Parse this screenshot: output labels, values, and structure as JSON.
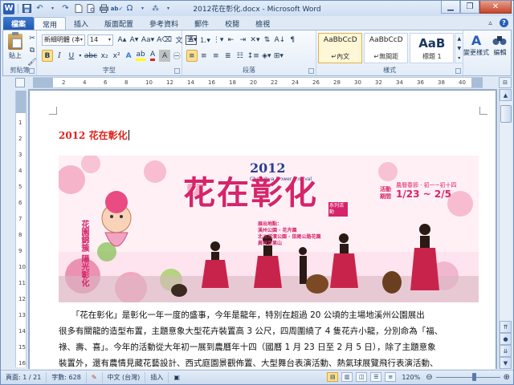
{
  "window": {
    "title": "2012花在彰化.docx - Microsoft Word"
  },
  "qat": {
    "app_icon": "W"
  },
  "tabs": {
    "file": "檔案",
    "items": [
      "常用",
      "插入",
      "版面配置",
      "參考資料",
      "郵件",
      "校閱",
      "檢視"
    ],
    "active_index": 0
  },
  "ribbon": {
    "clipboard": {
      "label": "剪貼簿",
      "paste": "貼上"
    },
    "font": {
      "label": "字型",
      "name": "新細明體 (本文",
      "size": "14"
    },
    "paragraph": {
      "label": "段落"
    },
    "styles": {
      "label": "樣式",
      "items": [
        {
          "sample": "AaBbCcD",
          "name": "↵內文"
        },
        {
          "sample": "AaBbCcD",
          "name": "↵無間距"
        },
        {
          "sample": "AaB",
          "name": "標題 1"
        }
      ],
      "selected_index": 0,
      "change_styles": "變更樣式"
    },
    "editing": {
      "label": "編輯"
    }
  },
  "ruler": {
    "numbers": [
      "2",
      "4",
      "6",
      "8",
      "10",
      "12",
      "14",
      "16",
      "18",
      "20",
      "22",
      "24",
      "26",
      "28",
      "30",
      "32",
      "34",
      "36",
      "38",
      "40"
    ],
    "v_numbers": [
      "1",
      "2",
      "3",
      "4",
      "5",
      "6",
      "7",
      "8",
      "9",
      "10",
      "11",
      "12",
      "13",
      "14",
      "15",
      "16"
    ]
  },
  "document": {
    "heading": "2012 花在彰化",
    "photo": {
      "year": "2012",
      "sub": "Changhua Flower Festival",
      "title": "花在彰化",
      "series": "系列活動",
      "date_label": "活動期間",
      "date_range": "農曆春節 · 初一~初十四",
      "dates": "1/23 ~ 2/5",
      "side_text": "花園錦簇 陽光彰化",
      "venue_lines": [
        "展出地點：",
        "溪州公園 · 花卉園",
        "北斗河濱公園 · 田尾公路花園",
        "員林百果山"
      ]
    },
    "paragraph_lines": [
      "　　「花在彰化」是彰化一年一度的盛事，今年是龍年，特別在超過 20 公頃的主場地溪州公園展出",
      "很多有關龍的造型布置，主題意象大型花卉裝置高 3 公尺，四周圍繞了 4 隻花卉小龍，分別命為「福、",
      "祿、壽、喜」。今年的活動從大年初一展到農曆年十四（國曆 1 月 23 日至 2 月 5 日），除了主題意象",
      "裝置外，還有農情見藏花藝設計、西式庭園景觀佈置、大型舞台表演活動、熱氣球展覽飛行表演活動、"
    ]
  },
  "status": {
    "page": "頁面: 1 / 21",
    "words": "字數: 628",
    "language": "中文 (台灣)",
    "mode": "插入",
    "zoom": "120%",
    "zoom_level": 0.6
  },
  "colors": {
    "accent": "#2b5db6",
    "heading": "#e0211b",
    "ribbon_bg": "#e3ecf7"
  }
}
